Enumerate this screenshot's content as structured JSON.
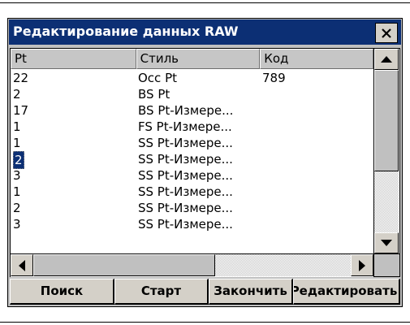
{
  "window": {
    "title": "Редактирование данных RAW",
    "close_label": "×"
  },
  "columns": [
    "Pt",
    "Стиль",
    "Код"
  ],
  "rows": [
    {
      "pt": "22",
      "style": "Occ Pt",
      "code": "789"
    },
    {
      "pt": "2",
      "style": "BS Pt",
      "code": ""
    },
    {
      "pt": "17",
      "style": "BS Pt-Измере...",
      "code": ""
    },
    {
      "pt": "1",
      "style": "FS Pt-Измере...",
      "code": ""
    },
    {
      "pt": "1",
      "style": "SS Pt-Измере...",
      "code": ""
    },
    {
      "pt": "2",
      "style": "SS Pt-Измере...",
      "code": "",
      "selected": true
    },
    {
      "pt": "3",
      "style": "SS Pt-Измере...",
      "code": ""
    },
    {
      "pt": "1",
      "style": "SS Pt-Измере...",
      "code": ""
    },
    {
      "pt": "2",
      "style": "SS Pt-Измере...",
      "code": ""
    },
    {
      "pt": "3",
      "style": "SS Pt-Измере...",
      "code": ""
    }
  ],
  "buttons": {
    "search": "Поиск",
    "start": "Старт",
    "finish": "Закончить",
    "edit": "Редактировать"
  },
  "colors": {
    "title_bar": "#0c2f74",
    "selection": "#0c2f74",
    "window_face": "#c0c0c0"
  },
  "icons": {
    "close": "close-icon",
    "scroll_up": "arrow-up-icon",
    "scroll_down": "arrow-down-icon",
    "scroll_left": "arrow-left-icon",
    "scroll_right": "arrow-right-icon"
  }
}
